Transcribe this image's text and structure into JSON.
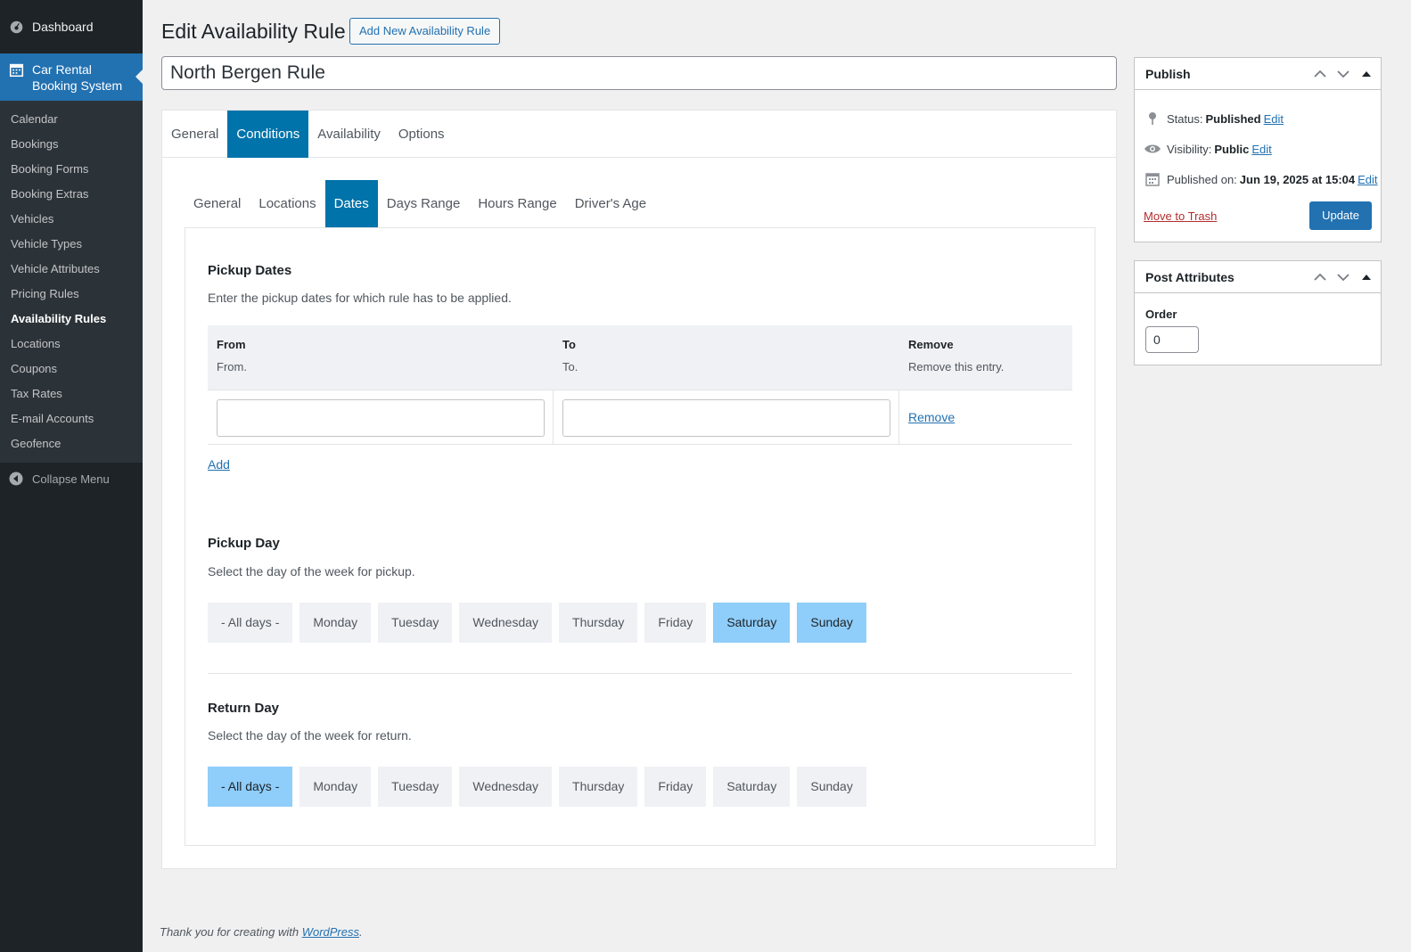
{
  "sidebar": {
    "dashboard": "Dashboard",
    "active_menu": {
      "line1": "Car Rental",
      "line2": "Booking System"
    },
    "items": [
      {
        "label": "Calendar"
      },
      {
        "label": "Bookings"
      },
      {
        "label": "Booking Forms"
      },
      {
        "label": "Booking Extras"
      },
      {
        "label": "Vehicles"
      },
      {
        "label": "Vehicle Types"
      },
      {
        "label": "Vehicle Attributes"
      },
      {
        "label": "Pricing Rules"
      },
      {
        "label": "Availability Rules"
      },
      {
        "label": "Locations"
      },
      {
        "label": "Coupons"
      },
      {
        "label": "Tax Rates"
      },
      {
        "label": "E-mail Accounts"
      },
      {
        "label": "Geofence"
      }
    ],
    "current_item": "Availability Rules",
    "collapse": "Collapse Menu"
  },
  "header": {
    "title": "Edit Availability Rule",
    "add_new": "Add New Availability Rule",
    "post_title": "North Bergen Rule"
  },
  "tabs": [
    "General",
    "Conditions",
    "Availability",
    "Options"
  ],
  "active_tab": "Conditions",
  "subtabs": [
    "General",
    "Locations",
    "Dates",
    "Days Range",
    "Hours Range",
    "Driver's Age"
  ],
  "active_subtab": "Dates",
  "pickup_dates": {
    "title": "Pickup Dates",
    "desc": "Enter the pickup dates for which rule has to be applied.",
    "columns": [
      {
        "header": "From",
        "sub": "From."
      },
      {
        "header": "To",
        "sub": "To."
      },
      {
        "header": "Remove",
        "sub": "Remove this entry."
      }
    ],
    "rows": [
      {
        "from": "",
        "to": "",
        "remove": "Remove"
      }
    ],
    "add": "Add"
  },
  "pickup_day": {
    "title": "Pickup Day",
    "desc": "Select the day of the week for pickup.",
    "options": [
      "- All days -",
      "Monday",
      "Tuesday",
      "Wednesday",
      "Thursday",
      "Friday",
      "Saturday",
      "Sunday"
    ],
    "selected": [
      "Saturday",
      "Sunday"
    ]
  },
  "return_day": {
    "title": "Return Day",
    "desc": "Select the day of the week for return.",
    "options": [
      "- All days -",
      "Monday",
      "Tuesday",
      "Wednesday",
      "Thursday",
      "Friday",
      "Saturday",
      "Sunday"
    ],
    "selected": [
      "- All days -"
    ]
  },
  "publish": {
    "title": "Publish",
    "status_label": "Status:",
    "status_value": "Published",
    "visibility_label": "Visibility:",
    "visibility_value": "Public",
    "published_label": "Published on:",
    "published_value": "Jun 19, 2025 at 15:04",
    "edit": "Edit",
    "trash": "Move to Trash",
    "update": "Update"
  },
  "post_attributes": {
    "title": "Post Attributes",
    "order_label": "Order",
    "order_value": "0"
  },
  "footer": {
    "text": "Thank you for creating with ",
    "link": "WordPress",
    "suffix": "."
  },
  "colors": {
    "sidebar_bg": "#1d2327",
    "accent": "#2271b1",
    "tab_active": "#0073aa",
    "day_selected": "#8fcdfa"
  },
  "icons": {
    "dashboard": "dashboard-icon",
    "car_rental": "calendar-icon",
    "collapse": "collapse-arrow-icon",
    "status": "pin-icon",
    "visibility": "eye-icon",
    "published": "calendar-icon"
  }
}
